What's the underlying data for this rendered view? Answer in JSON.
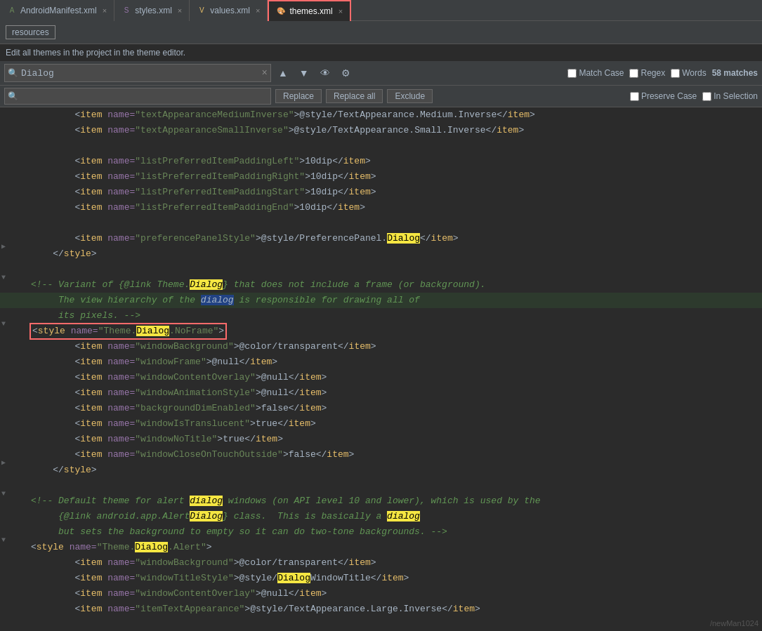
{
  "tabs": [
    {
      "id": "android-manifest",
      "label": "AndroidManifest.xml",
      "icon": "A",
      "active": false,
      "color": "#6a8759"
    },
    {
      "id": "styles-xml",
      "label": "styles.xml",
      "icon": "S",
      "active": false,
      "color": "#9876aa"
    },
    {
      "id": "values-xml",
      "label": "values.xml",
      "icon": "V",
      "active": false,
      "color": "#e8bf6a"
    },
    {
      "id": "themes-xml",
      "label": "themes.xml",
      "icon": "T",
      "active": true,
      "color": "#ff6b6b"
    }
  ],
  "resources_label": "resources",
  "info_text": "Edit all themes in the project in the theme editor.",
  "search": {
    "value": "Dialog",
    "placeholder": "Search",
    "replace_placeholder": "Replace",
    "match_case_label": "Match Case",
    "regex_label": "Regex",
    "words_label": "Words",
    "preserve_case_label": "Preserve Case",
    "in_selection_label": "In Selection",
    "matches": "58 matches",
    "replace_btn": "Replace",
    "replace_all_btn": "Replace all",
    "exclude_btn": "Exclude"
  },
  "watermark": "/newMan1024"
}
